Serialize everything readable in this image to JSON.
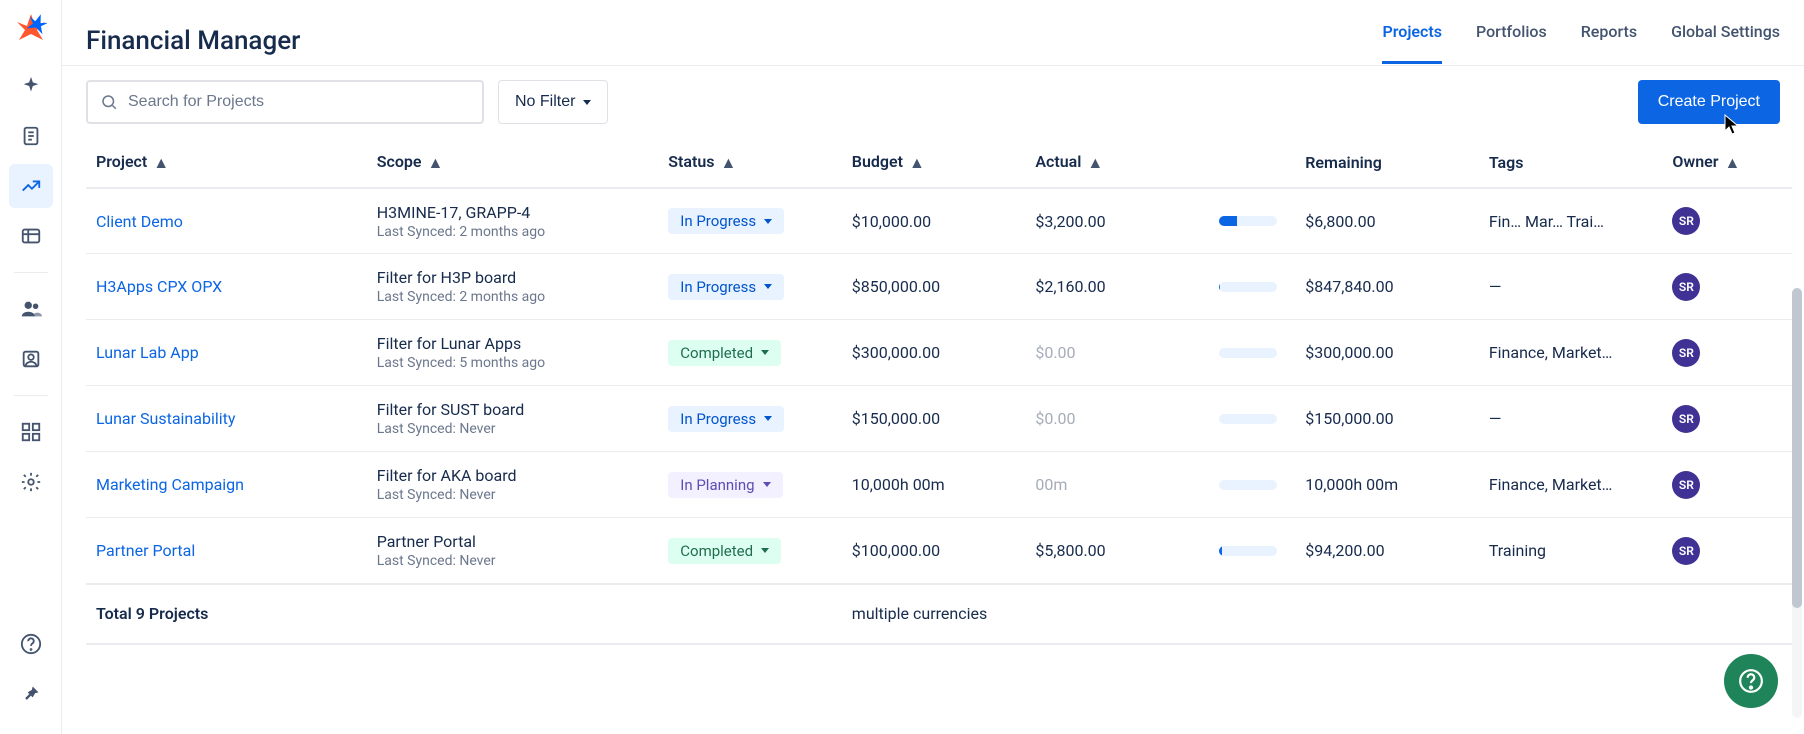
{
  "header": {
    "title": "Financial Manager",
    "tabs": [
      "Projects",
      "Portfolios",
      "Reports",
      "Global Settings"
    ],
    "active_tab": 0
  },
  "toolbar": {
    "search_placeholder": "Search for Projects",
    "filter_label": "No Filter",
    "create_label": "Create Project"
  },
  "columns": [
    "Project",
    "Scope",
    "Status",
    "Budget",
    "Actual",
    "",
    "Remaining",
    "Tags",
    "Owner"
  ],
  "status_styles": {
    "In Progress": "st-inprog",
    "Completed": "st-complete",
    "In Planning": "st-planning"
  },
  "rows": [
    {
      "project": "Client Demo",
      "scope": "H3MINE-17, GRAPP-4",
      "synced": "Last Synced: 2 months ago",
      "status": "In Progress",
      "budget": "$10,000.00",
      "actual": "$3,200.00",
      "actual_muted": false,
      "progress_pct": 32,
      "remaining": "$6,800.00",
      "tags": "Fin…   Mar…  Trai…",
      "owner": "SR"
    },
    {
      "project": "H3Apps CPX OPX",
      "scope": "Filter for H3P board",
      "synced": "Last Synced: 2 months ago",
      "status": "In Progress",
      "budget": "$850,000.00",
      "actual": "$2,160.00",
      "actual_muted": false,
      "progress_pct": 2,
      "remaining": "$847,840.00",
      "tags": "—",
      "owner": "SR"
    },
    {
      "project": "Lunar Lab App",
      "scope": "Filter for Lunar Apps",
      "synced": "Last Synced: 5 months ago",
      "status": "Completed",
      "budget": "$300,000.00",
      "actual": "$0.00",
      "actual_muted": true,
      "progress_pct": 0,
      "remaining": "$300,000.00",
      "tags": "Finance, Market…",
      "owner": "SR"
    },
    {
      "project": "Lunar Sustainability",
      "scope": "Filter for SUST board",
      "synced": "Last Synced: Never",
      "status": "In Progress",
      "budget": "$150,000.00",
      "actual": "$0.00",
      "actual_muted": true,
      "progress_pct": 0,
      "remaining": "$150,000.00",
      "tags": "—",
      "owner": "SR"
    },
    {
      "project": "Marketing Campaign",
      "scope": "Filter for AKA board",
      "synced": "Last Synced: Never",
      "status": "In Planning",
      "budget": "10,000h 00m",
      "actual": "00m",
      "actual_muted": true,
      "progress_pct": 0,
      "remaining": "10,000h 00m",
      "tags": "Finance, Market…",
      "owner": "SR"
    },
    {
      "project": "Partner Portal",
      "scope": "Partner Portal",
      "synced": "Last Synced: Never",
      "status": "Completed",
      "budget": "$100,000.00",
      "actual": "$5,800.00",
      "actual_muted": false,
      "progress_pct": 6,
      "remaining": "$94,200.00",
      "tags": "Training",
      "owner": "SR"
    }
  ],
  "footer": {
    "total_label": "Total 9 Projects",
    "currency_note": "multiple currencies"
  },
  "sidebar": {
    "items": [
      "spark",
      "doc",
      "chart",
      "table",
      "people",
      "person",
      "apps",
      "gear"
    ],
    "help": "help",
    "pin": "pin"
  }
}
